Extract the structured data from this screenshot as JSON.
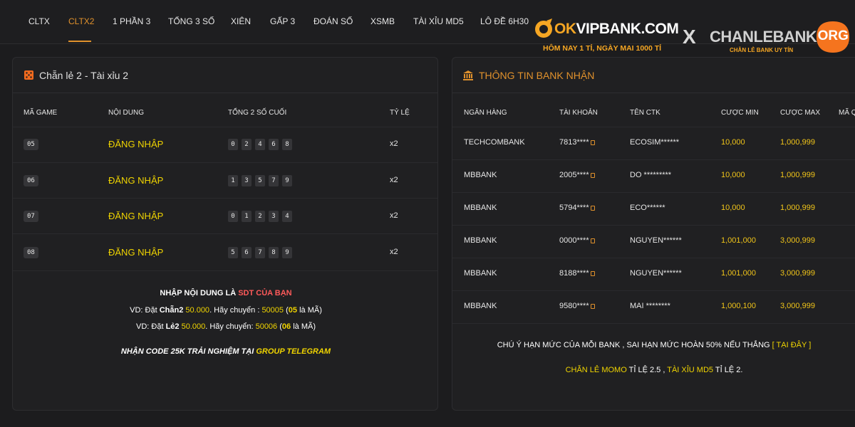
{
  "nav": {
    "tabs": [
      "CLTX",
      "CLTX2",
      "1 PHẦN 3",
      "TỔNG 3 SỐ",
      "XIÊN",
      "GẤP 3",
      "ĐOÁN SỐ",
      "XSMB",
      "TÀI XỈU MD5",
      "LÔ ĐỀ 6H30"
    ],
    "active_index": 1
  },
  "brand": {
    "okvip_prefix": "OK",
    "okvip_suffix": "VIPBANK.COM",
    "okvip_slogan": "HÔM NAY 1 TỈ, NGÀY MAI 1000 TỈ",
    "separator": "X",
    "chanlebank_name": "CHANLEBANK",
    "chanlebank_tld": "ORG",
    "chanlebank_slogan": "CHẴN LẺ BANK UY TÍN",
    "colors": {
      "accent": "#e0912c",
      "okvip": "#f5a623",
      "highlight": "#f0d400"
    }
  },
  "game_panel": {
    "icon": "dice-icon",
    "title": "Chẵn lẻ 2 - Tài xỉu 2",
    "headers": [
      "MÃ GAME",
      "NỘI DUNG",
      "TỔNG 2 SỐ CUỐI",
      "TỶ LỆ"
    ],
    "rows": [
      {
        "code": "05",
        "content": "ĐĂNG NHẬP",
        "digits": [
          "0",
          "2",
          "4",
          "6",
          "8"
        ],
        "ratio": "x2"
      },
      {
        "code": "06",
        "content": "ĐĂNG NHẬP",
        "digits": [
          "1",
          "3",
          "5",
          "7",
          "9"
        ],
        "ratio": "x2"
      },
      {
        "code": "07",
        "content": "ĐĂNG NHẬP",
        "digits": [
          "0",
          "1",
          "2",
          "3",
          "4"
        ],
        "ratio": "x2"
      },
      {
        "code": "08",
        "content": "ĐĂNG NHẬP",
        "digits": [
          "5",
          "6",
          "7",
          "8",
          "9"
        ],
        "ratio": "x2"
      }
    ],
    "instruction": {
      "line1_prefix": "NHẬP NỘI DUNG LÀ ",
      "line1_highlight": "SDT CỦA BẠN",
      "ex1_prefix": "VD: Đặt ",
      "ex1_bet": "Chẵn2",
      "ex1_amount": "50.000",
      "ex1_mid": ". Hãy chuyển : ",
      "ex1_code": "50005",
      "ex1_paren_open": " (",
      "ex1_id": "05",
      "ex1_suffix": " là MÃ)",
      "ex2_prefix": "VD: Đặt ",
      "ex2_bet": "Lẻ2",
      "ex2_amount": "50.000",
      "ex2_mid": ". Hãy chuyển: ",
      "ex2_code": "50006",
      "ex2_paren_open": " (",
      "ex2_id": "06",
      "ex2_suffix": " là MÃ)",
      "promo_prefix": "NHẬN CODE 25K TRẢI NGHIỆM TẠI ",
      "promo_link": "GROUP TELEGRAM"
    }
  },
  "bank_panel": {
    "icon": "bank-icon",
    "title": "THÔNG TIN BANK NHẬN",
    "headers": [
      "NGÂN HÀNG",
      "TÀI KHOẢN",
      "TÊN CTK",
      "CƯỢC MIN",
      "CƯỢC MAX",
      "MÃ Q"
    ],
    "rows": [
      {
        "bank": "TECHCOMBANK",
        "account": "7813****",
        "name": "ECOSIM******",
        "min": "10,000",
        "max": "1,000,999"
      },
      {
        "bank": "MBBANK",
        "account": "2005****",
        "name": "DO *********",
        "min": "10,000",
        "max": "1,000,999"
      },
      {
        "bank": "MBBANK",
        "account": "5794****",
        "name": "ECO******",
        "min": "10,000",
        "max": "1,000,999"
      },
      {
        "bank": "MBBANK",
        "account": "0000****",
        "name": "NGUYEN******",
        "min": "1,001,000",
        "max": "3,000,999"
      },
      {
        "bank": "MBBANK",
        "account": "8188****",
        "name": "NGUYEN******",
        "min": "1,001,000",
        "max": "3,000,999"
      },
      {
        "bank": "MBBANK",
        "account": "9580****",
        "name": "MAI ********",
        "min": "1,000,100",
        "max": "3,000,999"
      }
    ],
    "notice": {
      "text": "CHÚ Ý HẠN MỨC CỦA MỖI BANK , SAI HẠN MỨC HOÀN 50% NẾU THẮNG ",
      "link": "[ TẠI ĐÂY ]",
      "momo_link": "CHẴN LẺ MOMO",
      "momo_rate": " TỈ LỆ 2.5 , ",
      "md5_link": "TÀI XỈU MD5",
      "md5_rate": " TỈ LỆ 2."
    }
  }
}
